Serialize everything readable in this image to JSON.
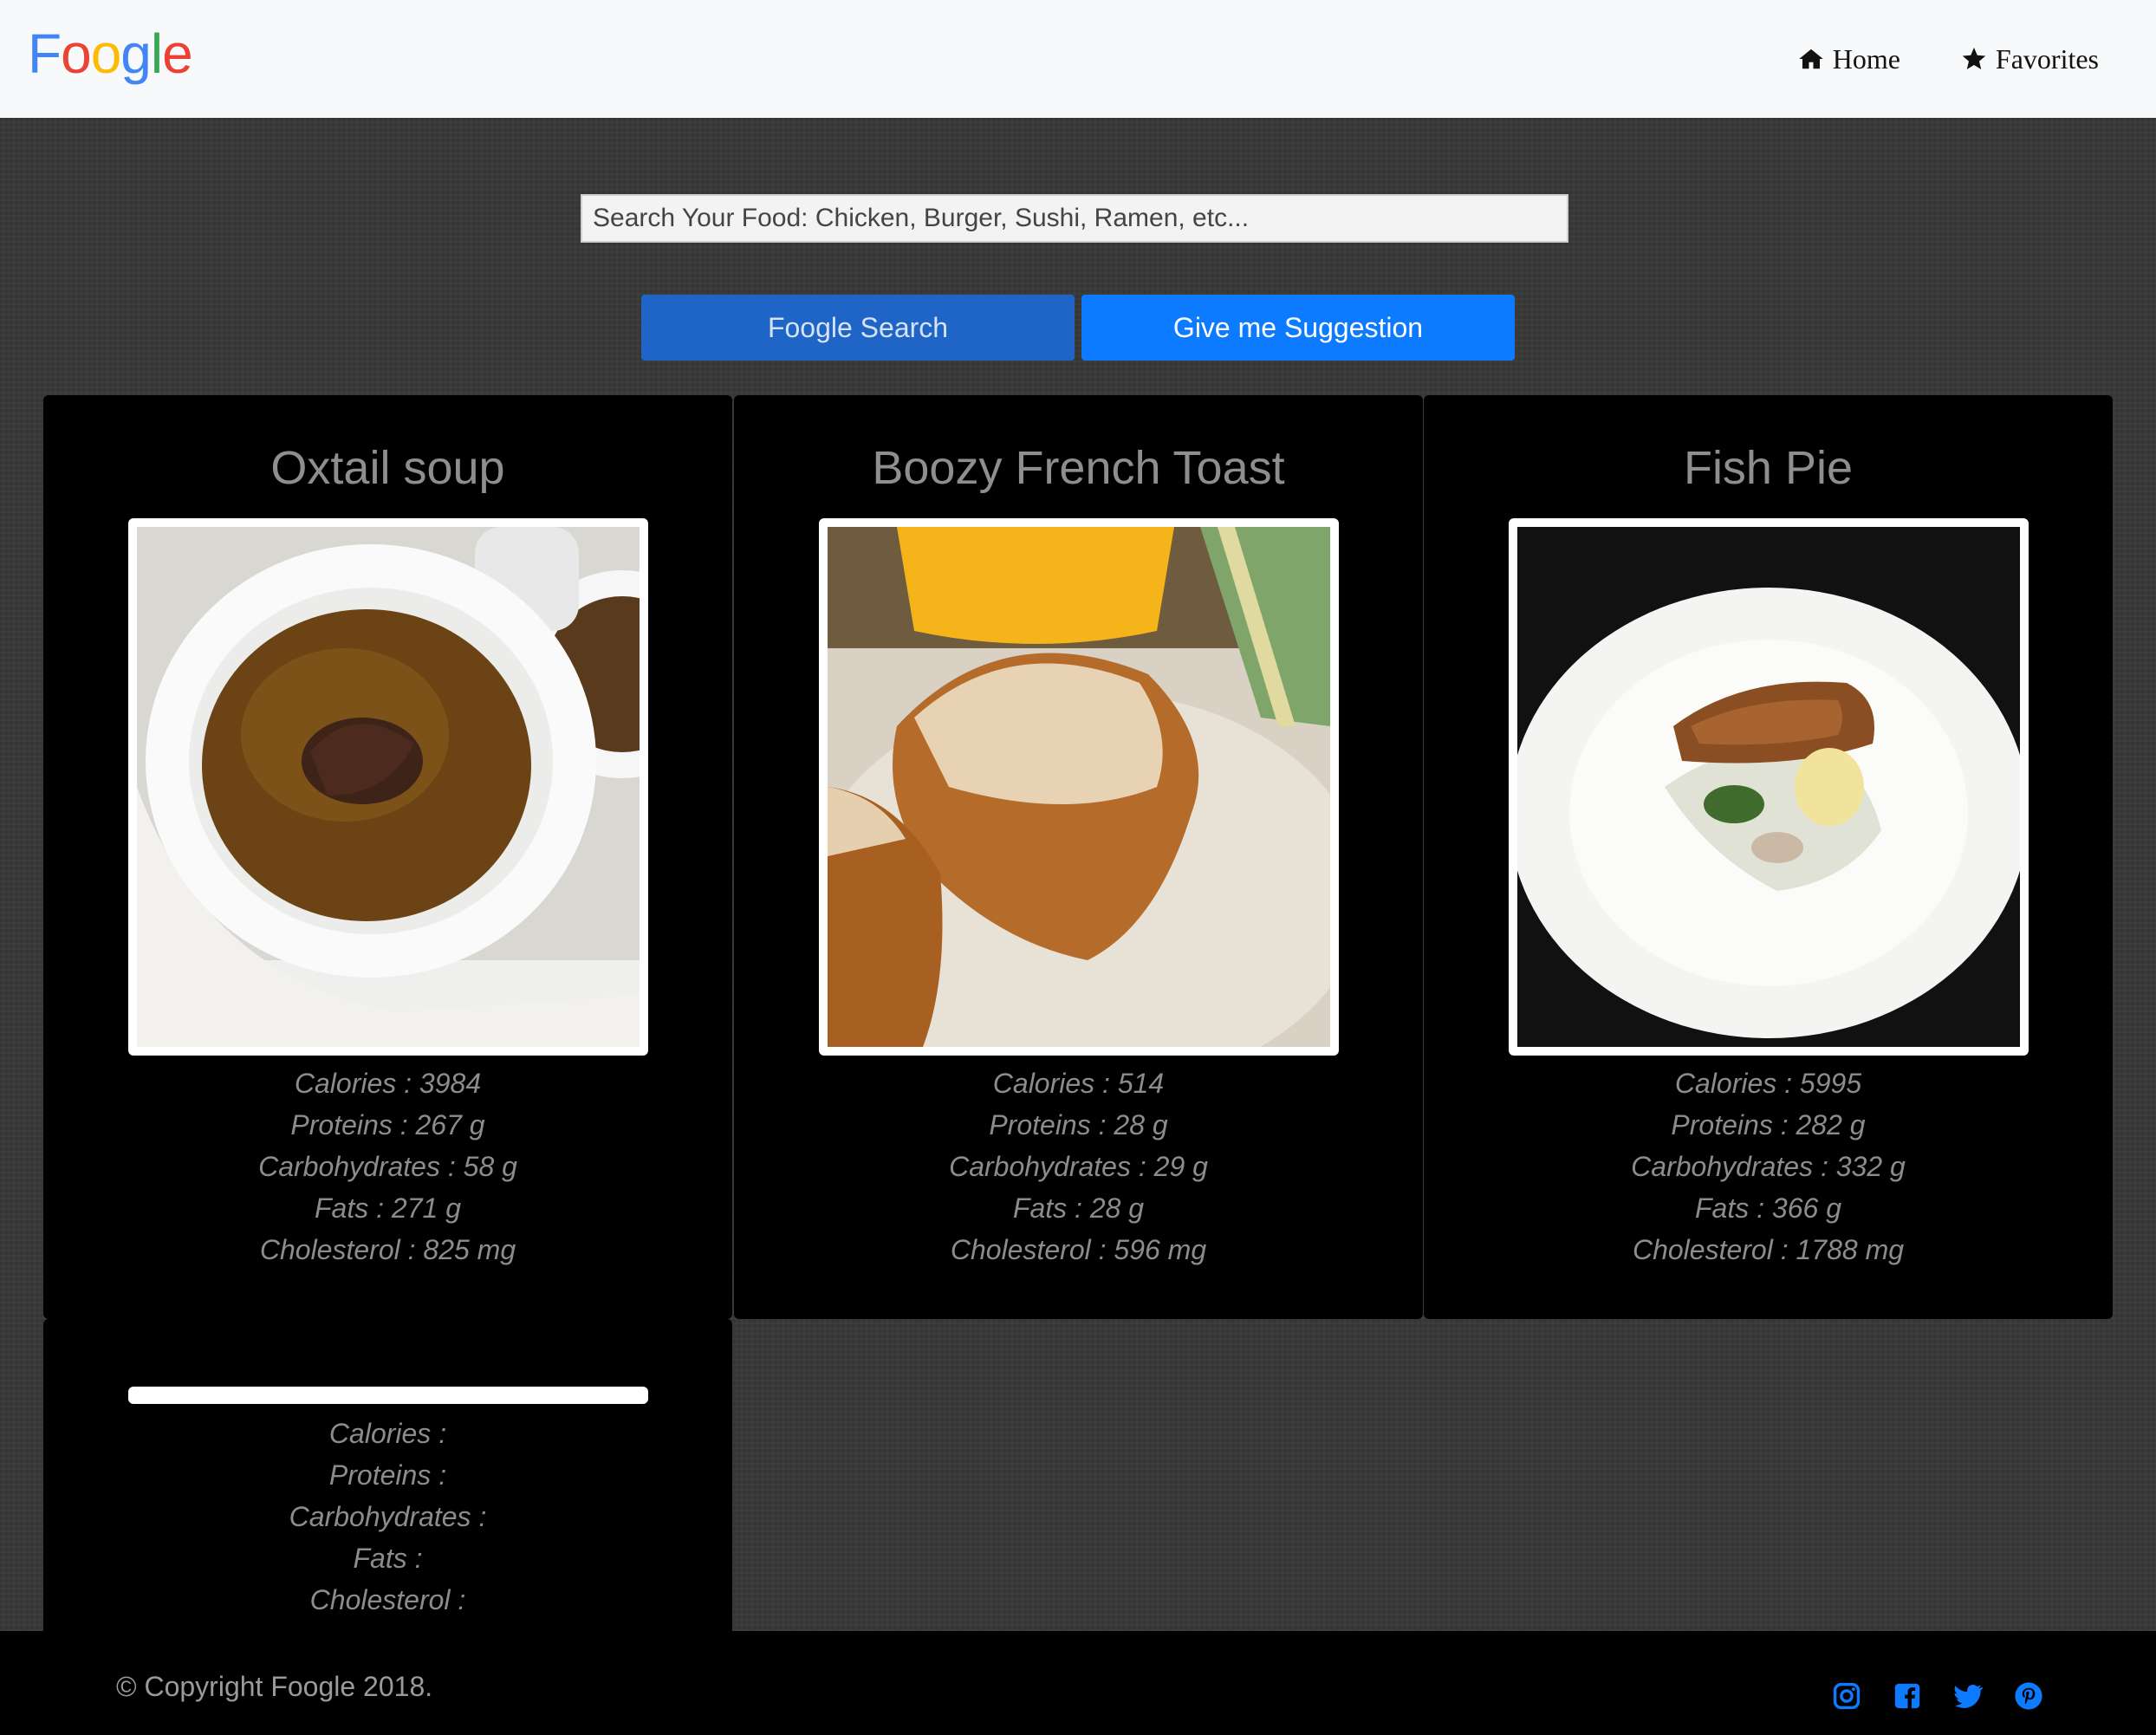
{
  "navbar": {
    "brand_letters": [
      {
        "char": "F",
        "color": "#4285F4"
      },
      {
        "char": "o",
        "color": "#EA4335"
      },
      {
        "char": "o",
        "color": "#FBBC05"
      },
      {
        "char": "g",
        "color": "#4285F4"
      },
      {
        "char": "l",
        "color": "#34A853"
      },
      {
        "char": "e",
        "color": "#EA4335"
      }
    ],
    "links": [
      {
        "label": "Home",
        "icon": "home-icon"
      },
      {
        "label": "Favorites",
        "icon": "star-icon"
      }
    ]
  },
  "search": {
    "placeholder": "Search Your Food: Chicken, Burger, Sushi, Ramen, etc...",
    "search_button": "Foogle Search",
    "suggest_button": "Give me Suggestion"
  },
  "cards": [
    {
      "title": "Oxtail soup",
      "image": "oxtail-soup-photo",
      "calories": "Calories : 3984",
      "proteins": "Proteins : 267 g",
      "carbohydrates": "Carbohydrates : 58 g",
      "fats": "Fats : 271 g",
      "cholesterol": "Cholesterol : 825 mg"
    },
    {
      "title": "Boozy French Toast",
      "image": "french-toast-photo",
      "calories": "Calories : 514",
      "proteins": "Proteins : 28 g",
      "carbohydrates": "Carbohydrates : 29 g",
      "fats": "Fats : 28 g",
      "cholesterol": "Cholesterol : 596 mg"
    },
    {
      "title": "Fish Pie",
      "image": "fish-pie-photo",
      "calories": "Calories : 5995",
      "proteins": "Proteins : 282 g",
      "carbohydrates": "Carbohydrates : 332 g",
      "fats": "Fats : 366 g",
      "cholesterol": "Cholesterol : 1788 mg"
    },
    {
      "title": "",
      "calories": "Calories :",
      "proteins": "Proteins :",
      "carbohydrates": "Carbohydrates :",
      "fats": "Fats :",
      "cholesterol": "Cholesterol :"
    }
  ],
  "footer": {
    "copyright": "© Copyright Foogle 2018.",
    "social_icons": [
      "instagram-icon",
      "facebook-icon",
      "twitter-icon",
      "pinterest-icon"
    ],
    "social_color": "#0d7bff"
  }
}
